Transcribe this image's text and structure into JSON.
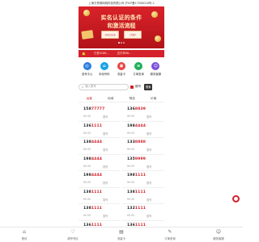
{
  "header": {
    "company_line": "上海万贸城网络科技有限公司 沪ICP备17008018号-2"
  },
  "banner": {
    "title": "实名认证的条件",
    "subtitle": "和激活流程",
    "card_labels": [
      "身份证正反面",
      "上传照片"
    ]
  },
  "notice": {
    "items": [
      "已售9186...",
      "支付享88..."
    ]
  },
  "shortcuts": [
    {
      "label": "选号中心",
      "color": "#2a7fe0",
      "glyph": "◎"
    },
    {
      "label": "本地号码",
      "color": "#19a2e6",
      "glyph": "⌂"
    },
    {
      "label": "流量卡",
      "color": "#e84545",
      "glyph": "▣"
    },
    {
      "label": "订单查询",
      "color": "#1fb05a",
      "glyph": "≡"
    },
    {
      "label": "服务客服",
      "color": "#7a4fd8",
      "glyph": "☺"
    }
  ],
  "search": {
    "placeholder": "输入尾号",
    "checkbox_label": "靓号",
    "button_label": "搜索"
  },
  "filters": [
    {
      "label": "运营",
      "active": true
    },
    {
      "label": "地域",
      "active": false
    },
    {
      "label": "筛选",
      "active": false
    },
    {
      "label": "价格",
      "active": false
    }
  ],
  "numbers": [
    {
      "prefix": "158",
      "tail": "77777",
      "price": "¥0.00",
      "note": "靓号"
    },
    {
      "prefix": "136",
      "tail": "8839",
      "price": "¥0.00",
      "note": "靓号"
    },
    {
      "prefix": "136",
      "tail": "1111",
      "price": "¥0.00",
      "note": "靓号"
    },
    {
      "prefix": "198",
      "tail": "4444",
      "price": "¥0.00",
      "note": "靓号"
    },
    {
      "prefix": "138",
      "tail": "4444",
      "price": "¥0.00",
      "note": "靓号"
    },
    {
      "prefix": "133",
      "tail": "8888",
      "price": "¥0.00",
      "note": "靓号"
    },
    {
      "prefix": "198",
      "tail": "4444",
      "price": "¥0.00",
      "note": "靓号"
    },
    {
      "prefix": "135",
      "tail": "9999",
      "price": "¥0.00",
      "note": "靓号"
    },
    {
      "prefix": "198",
      "tail": "4444",
      "price": "¥0.00",
      "note": "靓号"
    },
    {
      "prefix": "198",
      "tail": "1111",
      "price": "¥0.00",
      "note": "靓号"
    },
    {
      "prefix": "138",
      "tail": "1111",
      "price": "¥0.00",
      "note": "靓号"
    },
    {
      "prefix": "138",
      "tail": "1111",
      "price": "¥0.00",
      "note": "靓号"
    },
    {
      "prefix": "138",
      "tail": "1111",
      "price": "¥0.00",
      "note": "靓号"
    },
    {
      "prefix": "132",
      "tail": "1111",
      "price": "¥0.00",
      "note": "靓号"
    },
    {
      "prefix": "136",
      "tail": "1111",
      "price": "¥0.00",
      "note": "靓号"
    },
    {
      "prefix": "136",
      "tail": "1111",
      "price": "¥0.00",
      "note": "靓号"
    }
  ],
  "tabbar": [
    {
      "label": "首页",
      "glyph": "⌂",
      "active": false
    },
    {
      "label": "靓号专区",
      "glyph": "♡",
      "active": false
    },
    {
      "label": "流量卡",
      "glyph": "▤",
      "active": false
    },
    {
      "label": "订单查询",
      "glyph": "✎",
      "active": false
    },
    {
      "label": "服务客服",
      "glyph": "☺",
      "active": false
    }
  ]
}
